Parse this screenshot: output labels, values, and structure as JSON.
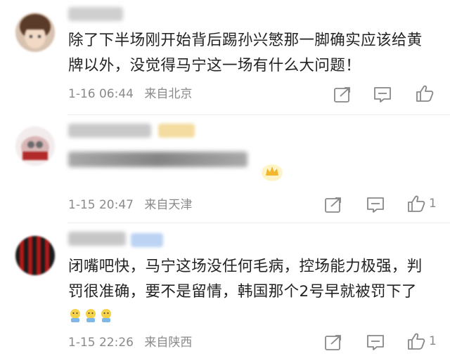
{
  "comments": [
    {
      "text": "除了下半场刚开始背后踢孙兴慜那一脚确实应该给黄牌以外，没觉得马宁这一场有什么大问题！",
      "date": "1-16 06:44",
      "location": "来自北京",
      "like_count": ""
    },
    {
      "date": "1-15 20:47",
      "location": "来自天津",
      "like_count": "1"
    },
    {
      "text": "闭嘴吧快，马宁这场没任何毛病，控场能力极强，判罚很准确，要不是留情，韩国那个2号早就被罚下了",
      "date": "1-15 22:26",
      "location": "来自陕西",
      "like_count": "1"
    }
  ],
  "icons": {
    "share": "share-icon",
    "comment": "comment-icon",
    "like": "thumbs-up-icon"
  }
}
